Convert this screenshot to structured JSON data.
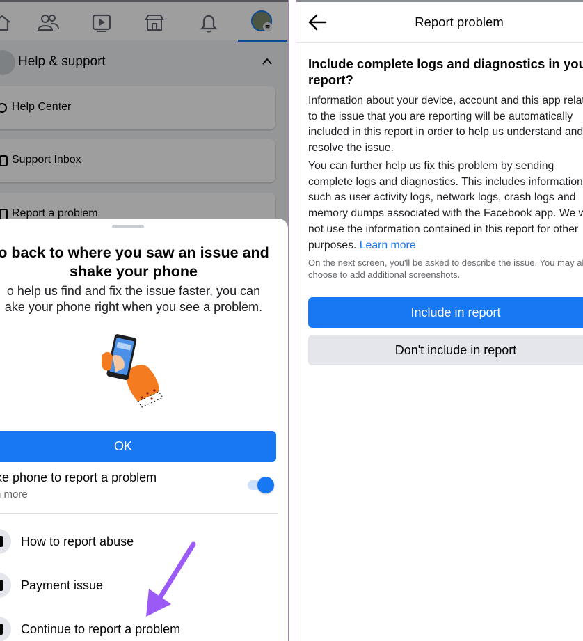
{
  "left": {
    "nav_icons": [
      "home-icon",
      "friends-icon",
      "video-icon",
      "marketplace-icon",
      "bell-icon",
      "profile-avatar"
    ],
    "help_section_title": "Help & support",
    "menu_items": [
      {
        "label": "Help Center",
        "icon": "help-center-icon"
      },
      {
        "label": "Support Inbox",
        "icon": "support-inbox-icon"
      },
      {
        "label": "Report a problem",
        "icon": "report-icon"
      }
    ],
    "sheet": {
      "title_line1": "o back to where you saw an issue and",
      "title_line2": "shake your phone",
      "desc_line1": "o help us find and fix the issue faster, you can",
      "desc_line2": "ake your phone right when you see a problem.",
      "ok_label": "OK",
      "shake_label": "ake phone to report a problem",
      "shake_sub": "rn more",
      "toggle_on": true,
      "options": [
        {
          "label": "How to report abuse",
          "icon": "report-abuse-icon"
        },
        {
          "label": "Payment issue",
          "icon": "payment-icon"
        },
        {
          "label": "Continue to report a problem",
          "icon": "bug-icon"
        }
      ]
    },
    "colors": {
      "accent": "#1877f2",
      "annotation_arrow": "#9b59f5"
    }
  },
  "right": {
    "title": "Report problem",
    "heading": "Include complete logs and diagnostics in your report?",
    "para1": "Information about your device, account and this app related to the issue that you are reporting will be automatically included in this report in order to help us understand and resolve the issue.",
    "para2": "You can further help us fix this problem by sending complete logs and diagnostics. This includes information such as user activity logs, network logs, crash logs and memory dumps associated with the Facebook app. We will not use the information contained in this report for other purposes.",
    "learn_more": "Learn more",
    "note": "On the next screen, you'll be asked to describe the issue. You may also choose to add additional screenshots.",
    "include_btn": "Include in report",
    "dont_include_btn": "Don't include in report"
  }
}
